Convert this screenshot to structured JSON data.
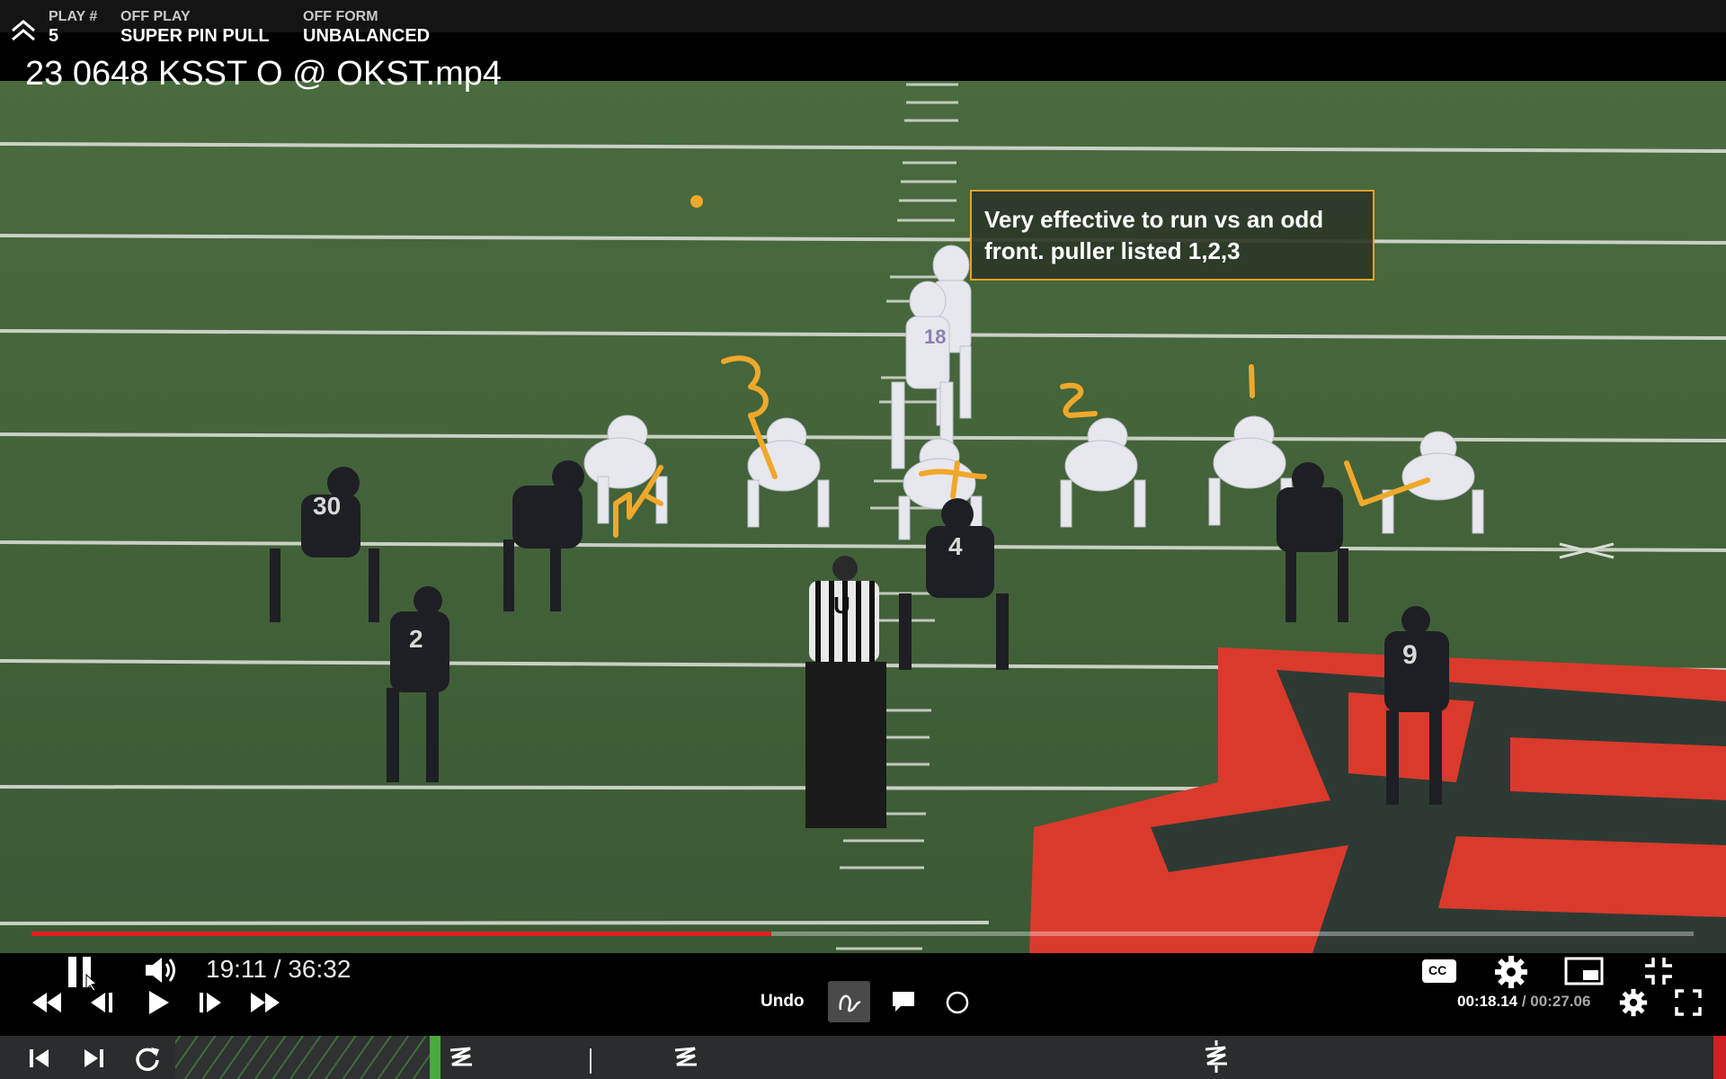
{
  "play_info": {
    "play_number_label": "PLAY #",
    "play_number_value": "5",
    "off_play_label": "OFF PLAY",
    "off_play_value": "SUPER PIN PULL",
    "off_form_label": "OFF FORM",
    "off_form_value": "UNBALANCED"
  },
  "video": {
    "title": "23 0648 KSST O @ OKST.mp4",
    "note": "Very effective to run vs an odd front. puller listed 1,2,3",
    "annotation_numbers": [
      "1",
      "2",
      "3"
    ]
  },
  "player_numbers": {
    "offense": [
      "18"
    ],
    "defense": [
      "30",
      "2",
      "4",
      "9"
    ],
    "official_letter": "U"
  },
  "controls": {
    "elapsed_time": "19:11 / 36:32",
    "progress_fraction": 0.445,
    "undo_label": "Undo",
    "clip_time_current": "00:18.14",
    "clip_time_separator": " / ",
    "clip_time_total": "00:27.06",
    "cc_label": "CC"
  },
  "colors": {
    "accent_orange": "#e8a22a",
    "progress_red": "#e01e1e",
    "field_green": "#3d5a35",
    "strip_green": "#49a93c",
    "osu_orange_red": "#d93a2b"
  },
  "icons": {
    "collapse": "double-chevron-up-icon",
    "pause": "pause-icon",
    "volume": "volume-icon",
    "rewind": "rewind-icon",
    "step_back": "step-back-icon",
    "play": "play-icon",
    "step_forward": "step-forward-icon",
    "fast_forward": "fast-forward-icon",
    "draw": "freehand-draw-icon",
    "comment": "comment-icon",
    "circle": "circle-tool-icon",
    "settings": "gear-icon",
    "pip": "picture-in-picture-icon",
    "exit_fullscreen": "exit-fullscreen-icon",
    "fullscreen": "fullscreen-icon",
    "skip_start": "skip-to-start-icon",
    "skip_end": "skip-to-end-icon",
    "replay": "replay-icon"
  }
}
